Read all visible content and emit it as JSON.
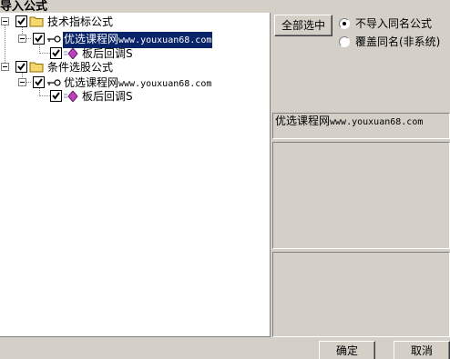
{
  "window": {
    "title": "导入公式"
  },
  "tree": {
    "groups": [
      {
        "label": "技术指标公式",
        "checked": true,
        "children": [
          {
            "label_cn": "优选课程网",
            "label_url": "www.youxuan68.com",
            "checked": true,
            "selected": true,
            "children": [
              {
                "label": "板后回调S",
                "checked": true
              }
            ]
          }
        ]
      },
      {
        "label": "条件选股公式",
        "checked": true,
        "children": [
          {
            "label_cn": "优选课程网",
            "label_url": "www.youxuan68.com",
            "checked": true,
            "selected": false,
            "children": [
              {
                "label": "板后回调S",
                "checked": true
              }
            ]
          }
        ]
      }
    ]
  },
  "options": {
    "select_all_label": "全部选中",
    "radio_no_import_label": "不导入同名公式",
    "radio_overwrite_label": "覆盖同名(非系统)",
    "selected_option": "no_import"
  },
  "info": {
    "description_cn": "优选课程网",
    "description_url": "www.youxuan68.com"
  },
  "footer": {
    "ok_label": "确定",
    "cancel_label": "取消"
  },
  "colors": {
    "selection": "#0a246a",
    "folder": "#f5d76e",
    "diamond": "#c040c0"
  }
}
